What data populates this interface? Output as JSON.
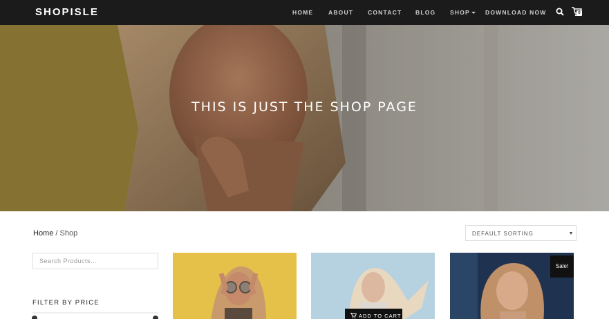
{
  "header": {
    "logo": "SHOPISLE",
    "nav": [
      {
        "label": "HOME"
      },
      {
        "label": "ABOUT"
      },
      {
        "label": "CONTACT"
      },
      {
        "label": "BLOG"
      },
      {
        "label": "SHOP",
        "has_dropdown": true
      },
      {
        "label": "DOWNLOAD NOW"
      }
    ],
    "search_icon": "search-icon",
    "cart_icon": "cart-icon",
    "cart_count": "0"
  },
  "hero": {
    "title": "THIS IS JUST THE SHOP PAGE"
  },
  "breadcrumb": {
    "home": "Home",
    "separator": " / ",
    "current": "Shop"
  },
  "sorting": {
    "selected": "DEFAULT SORTING"
  },
  "sidebar": {
    "search_placeholder": "Search Products…",
    "filter_title": "FILTER BY PRICE"
  },
  "products": [
    {
      "image": "woman with sunglasses on yellow background"
    },
    {
      "image": "blonde woman on light blue background",
      "button_label": "ADD TO CART"
    },
    {
      "image": "curly haired woman on dark blue background",
      "badge": "Sale!"
    }
  ],
  "colors": {
    "header_bg": "#1b1b1b",
    "text_primary": "#222222",
    "button_bg": "#111111"
  }
}
